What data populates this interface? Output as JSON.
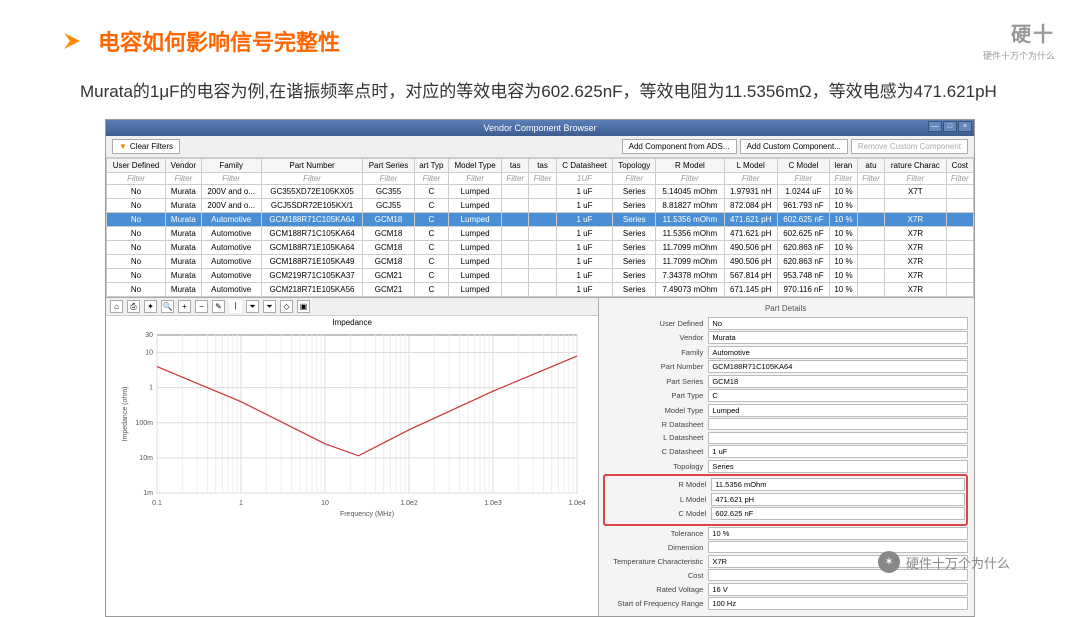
{
  "slide": {
    "title": "电容如何影响信号完整性",
    "brand_main": "硬十",
    "brand_sub": "硬件十万个为什么",
    "description": "Murata的1μF的电容为例,在谐振频率点时，对应的等效电容为602.625nF，等效电阻为11.5356mΩ，等效电感为471.621pH"
  },
  "window": {
    "title": "Vendor Component Browser",
    "clear_filters": "Clear Filters",
    "btn_add_ads": "Add Component from ADS...",
    "btn_add_custom": "Add Custom Component...",
    "btn_remove": "Remove Custom Component"
  },
  "table": {
    "headers": [
      "User Defined",
      "Vendor",
      "Family",
      "Part Number",
      "Part Series",
      "art Typ",
      "Model Type",
      "tas",
      "tas",
      "C Datasheet",
      "Topology",
      "R Model",
      "L Model",
      "C Model",
      "leran",
      "atu",
      "rature Charac",
      "Cost"
    ],
    "filter_label": "Filter",
    "filter_1uf": "1UF",
    "rows": [
      {
        "ud": "No",
        "v": "Murata",
        "f": "200V and o...",
        "pn": "GC355XD72E105KX05",
        "ps": "GC355",
        "pt": "C",
        "mt": "Lumped",
        "cd": "1 uF",
        "tp": "Series",
        "r": "5.14045 mOhm",
        "l": "1.97931 nH",
        "c": "1.0244 uF",
        "tol": "10 %",
        "tc": "X7T",
        "cost": ""
      },
      {
        "ud": "No",
        "v": "Murata",
        "f": "200V and o...",
        "pn": "GCJ5SDR72E105KX/1",
        "ps": "GCJ55",
        "pt": "C",
        "mt": "Lumped",
        "cd": "1 uF",
        "tp": "Series",
        "r": "8.81827 mOhm",
        "l": "872.084 pH",
        "c": "961.793 nF",
        "tol": "10 %",
        "tc": "",
        "cost": ""
      },
      {
        "ud": "No",
        "v": "Murata",
        "f": "Automotive",
        "pn": "GCM188R71C105KA64",
        "ps": "GCM18",
        "pt": "C",
        "mt": "Lumped",
        "cd": "1 uF",
        "tp": "Series",
        "r": "11.5356 mOhm",
        "l": "471.621 pH",
        "c": "602.625 nF",
        "tol": "10 %",
        "tc": "X7R",
        "cost": "",
        "hl": true
      },
      {
        "ud": "No",
        "v": "Murata",
        "f": "Automotive",
        "pn": "GCM188R71C105KA64",
        "ps": "GCM18",
        "pt": "C",
        "mt": "Lumped",
        "cd": "1 uF",
        "tp": "Series",
        "r": "11.5356 mOhm",
        "l": "471.621 pH",
        "c": "602.625 nF",
        "tol": "10 %",
        "tc": "X7R",
        "cost": ""
      },
      {
        "ud": "No",
        "v": "Murata",
        "f": "Automotive",
        "pn": "GCM188R71E105KA64",
        "ps": "GCM18",
        "pt": "C",
        "mt": "Lumped",
        "cd": "1 uF",
        "tp": "Series",
        "r": "11.7099 mOhm",
        "l": "490.506 pH",
        "c": "620.863 nF",
        "tol": "10 %",
        "tc": "X7R",
        "cost": ""
      },
      {
        "ud": "No",
        "v": "Murata",
        "f": "Automotive",
        "pn": "GCM188R71E105KA49",
        "ps": "GCM18",
        "pt": "C",
        "mt": "Lumped",
        "cd": "1 uF",
        "tp": "Series",
        "r": "11.7099 mOhm",
        "l": "490.506 pH",
        "c": "620.863 nF",
        "tol": "10 %",
        "tc": "X7R",
        "cost": ""
      },
      {
        "ud": "No",
        "v": "Murata",
        "f": "Automotive",
        "pn": "GCM219R71C105KA37",
        "ps": "GCM21",
        "pt": "C",
        "mt": "Lumped",
        "cd": "1 uF",
        "tp": "Series",
        "r": "7.34378 mOhm",
        "l": "567.814 pH",
        "c": "953.748 nF",
        "tol": "10 %",
        "tc": "X7R",
        "cost": ""
      },
      {
        "ud": "No",
        "v": "Murata",
        "f": "Automotive",
        "pn": "GCM218R71E105KA56",
        "ps": "GCM21",
        "pt": "C",
        "mt": "Lumped",
        "cd": "1 uF",
        "tp": "Series",
        "r": "7.49073 mOhm",
        "l": "671.145 pH",
        "c": "970.116 nF",
        "tol": "10 %",
        "tc": "X7R",
        "cost": ""
      }
    ]
  },
  "chart_data": {
    "type": "line",
    "title": "Impedance",
    "xlabel": "Frequency  (MHz)",
    "ylabel": "Impedance (ohm)",
    "x_ticks": [
      "0.1",
      "1",
      "10",
      "1.0e2",
      "1.0e3",
      "1.0e4"
    ],
    "y_ticks": [
      "1m",
      "10m",
      "100m",
      "1",
      "10",
      "30"
    ],
    "x_range_log10": [
      -1,
      4
    ],
    "y_range_log10": [
      -3,
      1.5
    ],
    "series": [
      {
        "name": "Impedance",
        "points": [
          {
            "x_log": -1,
            "y_log": 0.6
          },
          {
            "x_log": 0,
            "y_log": -0.4
          },
          {
            "x_log": 1,
            "y_log": -1.6
          },
          {
            "x_log": 1.4,
            "y_log": -1.94
          },
          {
            "x_log": 2,
            "y_log": -1.2
          },
          {
            "x_log": 3,
            "y_log": -0.1
          },
          {
            "x_log": 4,
            "y_log": 0.9
          }
        ]
      }
    ]
  },
  "details": {
    "title": "Part Details",
    "fields": [
      {
        "k": "User Defined",
        "v": "No"
      },
      {
        "k": "Vendor",
        "v": "Murata"
      },
      {
        "k": "Family",
        "v": "Automotive"
      },
      {
        "k": "Part Number",
        "v": "GCM188R71C105KA64"
      },
      {
        "k": "Part Series",
        "v": "GCM18"
      },
      {
        "k": "Part Type",
        "v": "C"
      },
      {
        "k": "Model Type",
        "v": "Lumped"
      },
      {
        "k": "R Datasheet",
        "v": ""
      },
      {
        "k": "L Datasheet",
        "v": ""
      },
      {
        "k": "C Datasheet",
        "v": "1 uF"
      },
      {
        "k": "Topology",
        "v": "Series"
      }
    ],
    "boxed": [
      {
        "k": "R Model",
        "v": "11.5356 mOhm"
      },
      {
        "k": "L Model",
        "v": "471.621 pH"
      },
      {
        "k": "C Model",
        "v": "602.625 nF"
      }
    ],
    "after": [
      {
        "k": "Tolerance",
        "v": "10 %"
      },
      {
        "k": "Dimension",
        "v": ""
      },
      {
        "k": "Temperature Characteristic",
        "v": "X7R"
      },
      {
        "k": "Cost",
        "v": ""
      },
      {
        "k": "Rated Voltage",
        "v": "16 V"
      },
      {
        "k": "Start of Frequency Range",
        "v": "100 Hz"
      }
    ]
  },
  "watermark": "硬件十万个为什么"
}
